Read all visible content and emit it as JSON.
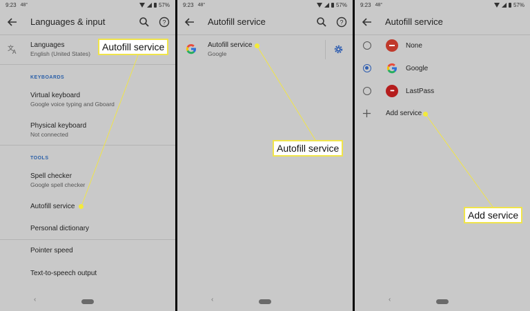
{
  "status": {
    "time": "9:23",
    "notif": "48°",
    "battery": "57%"
  },
  "panel1": {
    "title": "Languages & input",
    "languages": {
      "title": "Languages",
      "sub": "English (United States)"
    },
    "keyboards_header": "KEYBOARDS",
    "virtual_keyboard": {
      "title": "Virtual keyboard",
      "sub": "Google voice typing and Gboard"
    },
    "physical_keyboard": {
      "title": "Physical keyboard",
      "sub": "Not connected"
    },
    "tools_header": "TOOLS",
    "spell_checker": {
      "title": "Spell checker",
      "sub": "Google spell checker"
    },
    "autofill_service": "Autofill service",
    "personal_dictionary": "Personal dictionary",
    "pointer_speed": "Pointer speed",
    "tts_output": "Text-to-speech output",
    "callout": "Autofill service"
  },
  "panel2": {
    "title": "Autofill service",
    "service": {
      "title": "Autofill service",
      "sub": "Google"
    },
    "callout": "Autofill service"
  },
  "panel3": {
    "title": "Autofill service",
    "options": [
      {
        "label": "None",
        "selected": false
      },
      {
        "label": "Google",
        "selected": true
      },
      {
        "label": "LastPass",
        "selected": false
      }
    ],
    "lastpass_logo_text": "•••",
    "add_service": "Add service",
    "callout": "Add service"
  },
  "nav": {
    "back": "‹"
  },
  "colors": {
    "screen": "#c9c9c9",
    "accent": "#2e5db0",
    "callout_border": "#f0e44a",
    "dot": "#f3ea3a"
  }
}
